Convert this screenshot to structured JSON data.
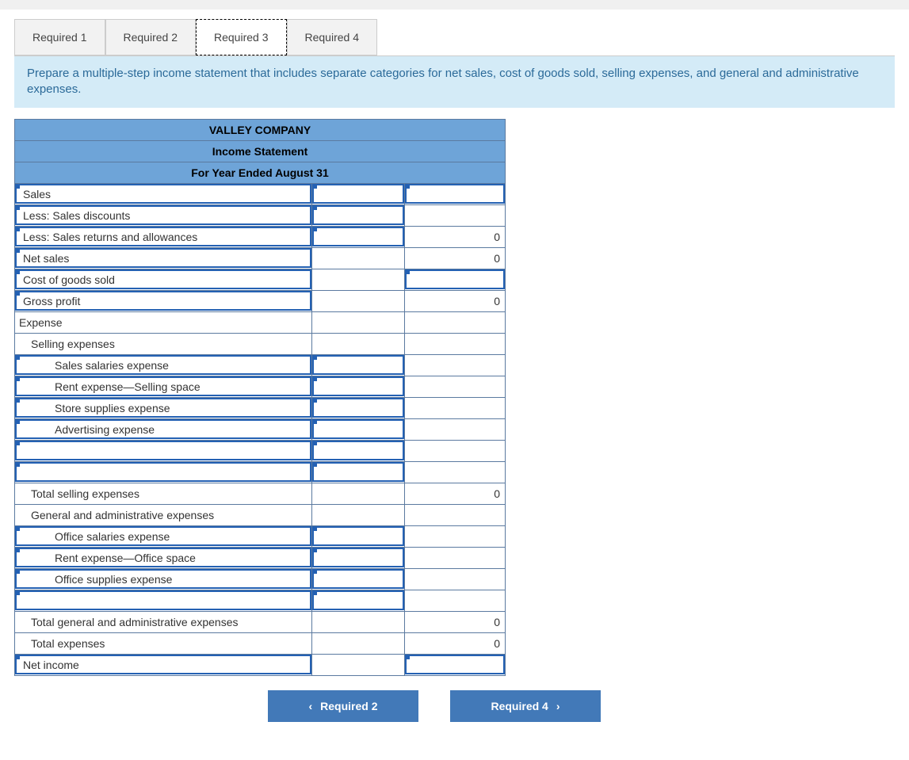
{
  "tabs": [
    {
      "label": "Required 1",
      "active": false
    },
    {
      "label": "Required 2",
      "active": false
    },
    {
      "label": "Required 3",
      "active": true
    },
    {
      "label": "Required 4",
      "active": false
    }
  ],
  "instruction": "Prepare a multiple-step income statement that includes separate categories for net sales, cost of goods sold, selling expenses, and general and administrative expenses.",
  "header": {
    "company": "VALLEY COMPANY",
    "title": "Income Statement",
    "period": "For Year Ended August 31"
  },
  "rows": [
    {
      "type": "field_label",
      "label": "Sales",
      "mid": "field",
      "mid_val": "",
      "right": "field",
      "right_val": ""
    },
    {
      "type": "field_label",
      "label": "Less: Sales discounts",
      "mid": "field",
      "mid_val": "",
      "right": "plain",
      "right_val": ""
    },
    {
      "type": "field_label",
      "label": "Less: Sales returns and allowances",
      "mid": "field",
      "mid_val": "",
      "right": "plain",
      "right_val": "0"
    },
    {
      "type": "field_label",
      "label": "Net sales",
      "mid": "plain",
      "mid_val": "",
      "right": "plain",
      "right_val": "0"
    },
    {
      "type": "field_label",
      "label": "Cost of goods sold",
      "mid": "plain",
      "mid_val": "",
      "right": "field",
      "right_val": ""
    },
    {
      "type": "field_label",
      "label": "Gross profit",
      "mid": "plain",
      "mid_val": "",
      "right": "plain",
      "right_val": "0"
    },
    {
      "type": "plain_label",
      "label": "Expense",
      "mid": "plain",
      "mid_val": "",
      "right": "plain",
      "right_val": ""
    },
    {
      "type": "plain_label",
      "label": "Selling expenses",
      "indent": 1,
      "mid": "plain",
      "mid_val": "",
      "right": "plain",
      "right_val": ""
    },
    {
      "type": "field_label",
      "label": "Sales salaries expense",
      "indent": 2,
      "mid": "field",
      "mid_val": "",
      "right": "plain",
      "right_val": ""
    },
    {
      "type": "field_label",
      "label": "Rent expense—Selling space",
      "indent": 2,
      "mid": "field",
      "mid_val": "",
      "right": "plain",
      "right_val": ""
    },
    {
      "type": "field_label",
      "label": "Store supplies expense",
      "indent": 2,
      "mid": "field",
      "mid_val": "",
      "right": "plain",
      "right_val": ""
    },
    {
      "type": "field_label",
      "label": "Advertising expense",
      "indent": 2,
      "mid": "field",
      "mid_val": "",
      "right": "plain",
      "right_val": ""
    },
    {
      "type": "field_label",
      "label": "",
      "mid": "field",
      "mid_val": "",
      "right": "plain",
      "right_val": ""
    },
    {
      "type": "field_label",
      "label": "",
      "mid": "field",
      "mid_val": "",
      "right": "plain",
      "right_val": ""
    },
    {
      "type": "plain_label",
      "label": "Total selling expenses",
      "indent": 1,
      "mid": "plain",
      "mid_val": "",
      "right": "plain",
      "right_val": "0"
    },
    {
      "type": "plain_label",
      "label": "General and administrative expenses",
      "indent": 1,
      "mid": "plain",
      "mid_val": "",
      "right": "plain",
      "right_val": ""
    },
    {
      "type": "field_label",
      "label": "Office salaries expense",
      "indent": 2,
      "mid": "field",
      "mid_val": "",
      "right": "plain",
      "right_val": ""
    },
    {
      "type": "field_label",
      "label": "Rent expense—Office space",
      "indent": 2,
      "mid": "field",
      "mid_val": "",
      "right": "plain",
      "right_val": ""
    },
    {
      "type": "field_label",
      "label": "Office supplies expense",
      "indent": 2,
      "mid": "field",
      "mid_val": "",
      "right": "plain",
      "right_val": ""
    },
    {
      "type": "field_label",
      "label": "",
      "mid": "field",
      "mid_val": "",
      "right": "plain",
      "right_val": ""
    },
    {
      "type": "plain_label",
      "label": "Total general and administrative expenses",
      "indent": 1,
      "mid": "plain",
      "mid_val": "",
      "right": "plain",
      "right_val": "0"
    },
    {
      "type": "plain_label",
      "label": "Total expenses",
      "indent": 1,
      "mid": "plain",
      "mid_val": "",
      "right": "plain",
      "right_val": "0"
    },
    {
      "type": "field_label",
      "label": "Net income",
      "mid": "plain",
      "mid_val": "",
      "right": "field",
      "right_val": ""
    }
  ],
  "nav": {
    "prev": "Required 2",
    "next": "Required 4"
  }
}
